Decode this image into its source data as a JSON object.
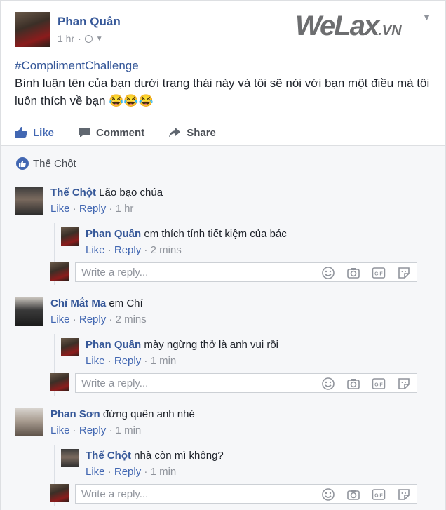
{
  "post": {
    "author": "Phan Quân",
    "time": "1 hr",
    "watermark_main": "WeLax",
    "watermark_suffix": ".VN",
    "hashtag": "#ComplimentChallenge",
    "body": "Bình luận tên của bạn dưới trạng thái này và tôi sẽ nói với bạn một điều mà tôi luôn thích về bạn",
    "emoji": "😂😂😂"
  },
  "actions": {
    "like": "Like",
    "comment": "Comment",
    "share": "Share"
  },
  "likes": {
    "names": "Thế Chột"
  },
  "links": {
    "like": "Like",
    "reply": "Reply"
  },
  "reply_placeholder": "Write a reply...",
  "comments": [
    {
      "name": "Thế Chột",
      "text": "Lão bạo chúa",
      "time": "1 hr",
      "reply": {
        "name": "Phan Quân",
        "text": "em thích tính tiết kiệm của bác",
        "time": "2 mins"
      }
    },
    {
      "name": "Chí Mắt Ma",
      "text": "em Chí",
      "time": "2 mins",
      "reply": {
        "name": "Phan Quân",
        "text": "mày ngừng thở là anh vui rồi",
        "time": "1 min"
      }
    },
    {
      "name": "Phan Sơn",
      "text": "đừng quên anh nhé",
      "time": "1 min",
      "reply": {
        "name": "Thế Chột",
        "text": "nhà còn mì không?",
        "time": "1 min"
      }
    }
  ],
  "colors": {
    "link_blue": "#365899",
    "action_blue": "#4267b2",
    "gray": "#90949c",
    "bg": "#f6f7f9"
  },
  "icons": [
    "like-icon",
    "comment-icon",
    "share-icon",
    "globe-icon",
    "smiley-icon",
    "camera-icon",
    "gif-icon",
    "sticker-icon",
    "chevron-down-icon"
  ]
}
